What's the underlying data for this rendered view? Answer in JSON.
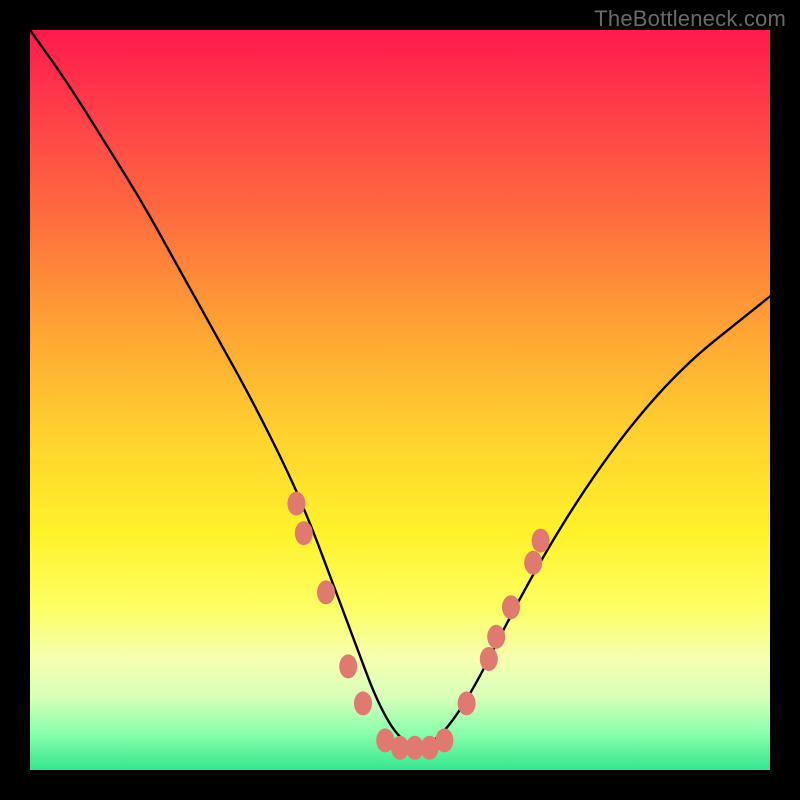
{
  "watermark": "TheBottleneck.com",
  "chart_data": {
    "type": "line",
    "title": "",
    "xlabel": "",
    "ylabel": "",
    "xlim": [
      0,
      100
    ],
    "ylim": [
      0,
      100
    ],
    "background_gradient": {
      "top_color": "#ff1a4d",
      "bottom_color": "#35e58e",
      "meaning": "red=high bottleneck, green=low bottleneck"
    },
    "series": [
      {
        "name": "bottleneck-curve",
        "color": "#000000",
        "x": [
          0,
          5,
          10,
          15,
          20,
          25,
          30,
          35,
          38,
          41,
          44,
          47,
          50,
          53,
          56,
          60,
          65,
          70,
          75,
          80,
          85,
          90,
          95,
          100
        ],
        "y": [
          100,
          93,
          85,
          77,
          68,
          59,
          50,
          40,
          33,
          25,
          17,
          9,
          4,
          3,
          5,
          11,
          21,
          30,
          38,
          45,
          51,
          56,
          60,
          64
        ]
      }
    ],
    "markers": {
      "name": "highlight-points",
      "color": "#e0796f",
      "shape": "rounded",
      "points": [
        {
          "x": 36,
          "y": 36
        },
        {
          "x": 37,
          "y": 32
        },
        {
          "x": 40,
          "y": 24
        },
        {
          "x": 43,
          "y": 14
        },
        {
          "x": 45,
          "y": 9
        },
        {
          "x": 48,
          "y": 4
        },
        {
          "x": 50,
          "y": 3
        },
        {
          "x": 52,
          "y": 3
        },
        {
          "x": 54,
          "y": 3
        },
        {
          "x": 56,
          "y": 4
        },
        {
          "x": 59,
          "y": 9
        },
        {
          "x": 62,
          "y": 15
        },
        {
          "x": 63,
          "y": 18
        },
        {
          "x": 65,
          "y": 22
        },
        {
          "x": 68,
          "y": 28
        },
        {
          "x": 69,
          "y": 31
        }
      ]
    }
  }
}
